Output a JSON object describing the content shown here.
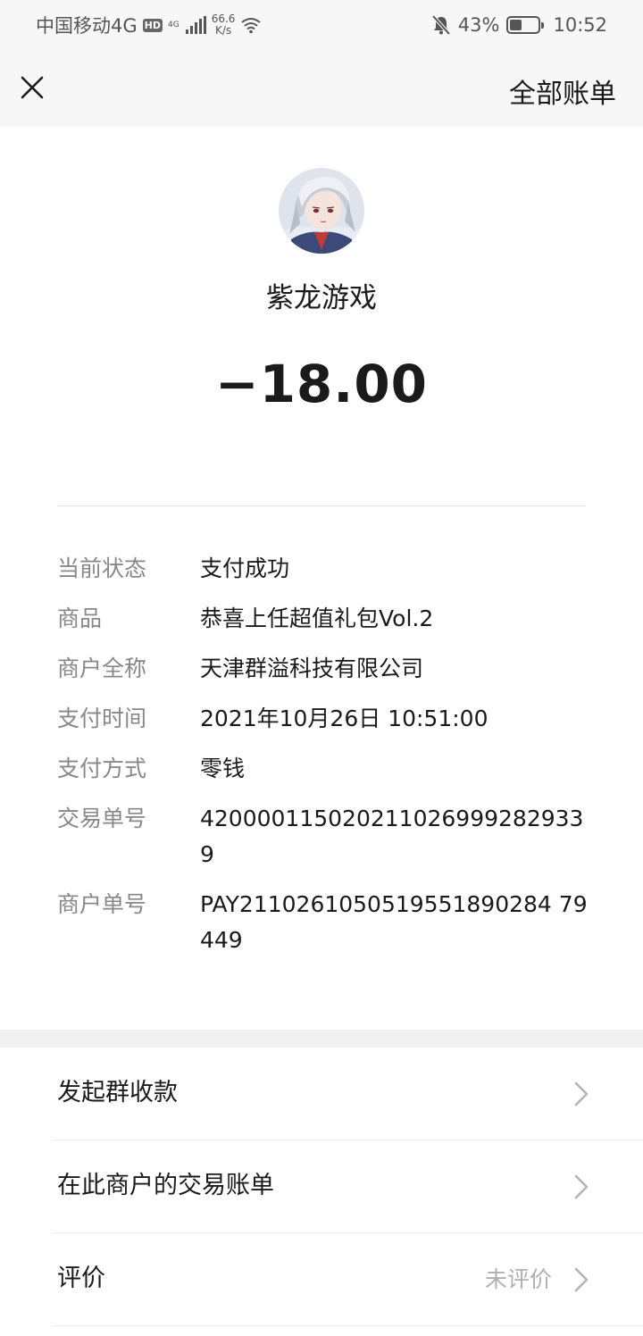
{
  "status_bar": {
    "carrier": "中国移动4G",
    "hd": "HD",
    "net": "4G",
    "speed_value": "66.6",
    "speed_unit": "K/s",
    "battery": "43%",
    "battery_level": 0.43,
    "time": "10:52"
  },
  "nav": {
    "all_bills": "全部账单"
  },
  "merchant": {
    "name": "紫龙游戏",
    "amount": "−18.00"
  },
  "details": [
    {
      "label": "当前状态",
      "value": "支付成功"
    },
    {
      "label": "商品",
      "value": "恭喜上任超值礼包Vol.2"
    },
    {
      "label": "商户全称",
      "value": "天津群溢科技有限公司"
    },
    {
      "label": "支付时间",
      "value": "2021年10月26日 10:51:00"
    },
    {
      "label": "支付方式",
      "value": "零钱"
    },
    {
      "label": "交易单号",
      "value": "4200001150202110269992829339"
    },
    {
      "label": "商户单号",
      "value": "PAY2110261050519551890284 79449"
    }
  ],
  "menu": [
    {
      "label": "发起群收款",
      "right": ""
    },
    {
      "label": "在此商户的交易账单",
      "right": ""
    },
    {
      "label": "评价",
      "right": "未评价"
    }
  ]
}
